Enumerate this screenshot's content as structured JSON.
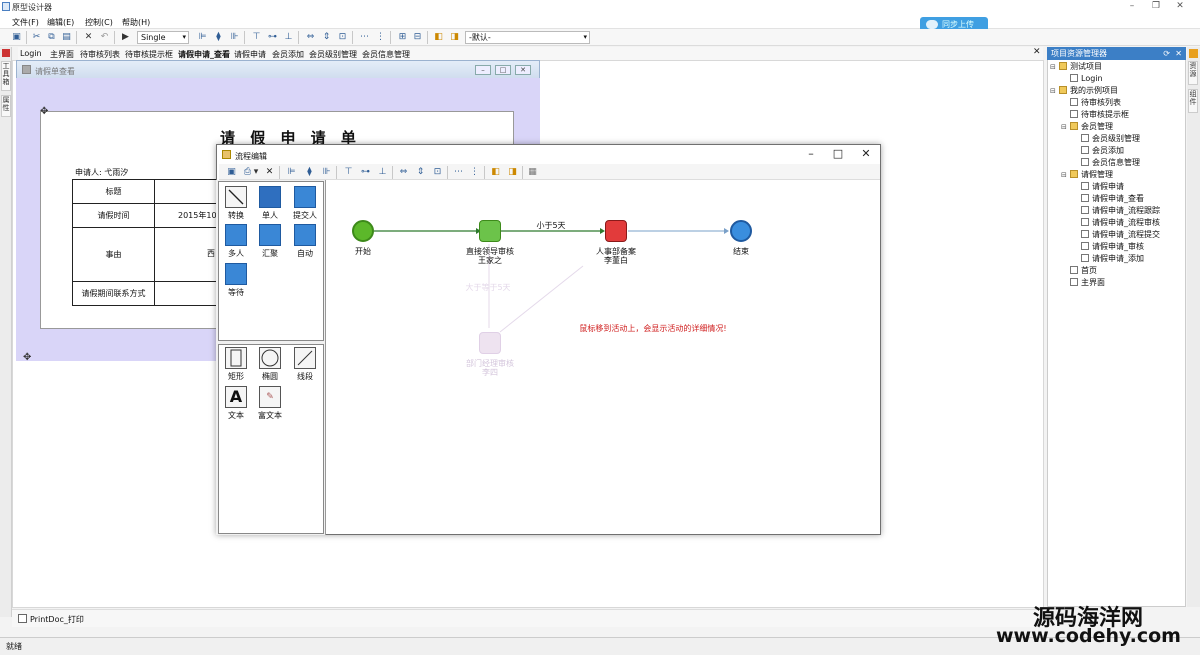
{
  "app": {
    "title": "原型设计器"
  },
  "menu": {
    "items": [
      "文件(F)",
      "编辑(E)",
      "控制(C)",
      "帮助(H)"
    ]
  },
  "toolbar": {
    "mode_select": "Single",
    "default_select": "-默认-"
  },
  "cloud_button": {
    "label": "同步上传"
  },
  "tabs": [
    "Login",
    "主界面",
    "待审核列表",
    "待审核提示框",
    "请假申请_查看",
    "请假申请",
    "会员添加",
    "会员级别管理",
    "会员信息管理"
  ],
  "left_strip": {
    "labels": [
      "工具箱",
      "属性"
    ]
  },
  "form_window": {
    "title": "请假单查看",
    "form_title": "请 假 申 请 单",
    "applicant": "申请人:  弋雨汐",
    "rows": [
      "标题",
      "请假时间",
      "事由",
      "请假期间联系方式"
    ],
    "date_value": "2015年10月",
    "reason_value": "西"
  },
  "flow_window": {
    "title": "流程编辑",
    "palette": [
      "转换",
      "单人",
      "提交人",
      "多人",
      "汇聚",
      "自动",
      "等待"
    ],
    "shapes": [
      "矩形",
      "椭圆",
      "线段",
      "文本",
      "富文本"
    ],
    "nodes": {
      "start": "开始",
      "direct": "直接领导审核",
      "direct_person": "王家之",
      "hr": "人事部备案",
      "hr_person": "李董白",
      "end": "结束",
      "dept": "部门经理审核",
      "dept_person": "李四"
    },
    "edge_label": "小于5天",
    "faded_edge_label": "大于等于5天",
    "hint": "鼠标移到活动上，会显示活动的详细情况!"
  },
  "project_panel": {
    "title": "项目资源管理器",
    "tree": [
      {
        "label": "测试项目",
        "level": 0
      },
      {
        "label": "Login",
        "level": 1
      },
      {
        "label": "我的示例项目",
        "level": 0
      },
      {
        "label": "待审核列表",
        "level": 1
      },
      {
        "label": "待审核提示框",
        "level": 1
      },
      {
        "label": "会员管理",
        "level": 1
      },
      {
        "label": "会员级别管理",
        "level": 2
      },
      {
        "label": "会员添加",
        "level": 2
      },
      {
        "label": "会员信息管理",
        "level": 2
      },
      {
        "label": "请假管理",
        "level": 1
      },
      {
        "label": "请假申请",
        "level": 2
      },
      {
        "label": "请假申请_查看",
        "level": 2
      },
      {
        "label": "请假申请_流程跟踪",
        "level": 2
      },
      {
        "label": "请假申请_流程审核",
        "level": 2
      },
      {
        "label": "请假申请_流程提交",
        "level": 2
      },
      {
        "label": "请假申请_审核",
        "level": 2
      },
      {
        "label": "请假申请_添加",
        "level": 2
      },
      {
        "label": "首页",
        "level": 1
      },
      {
        "label": "主界面",
        "level": 1
      }
    ]
  },
  "right_strip": {
    "labels": [
      "资源",
      "组件"
    ]
  },
  "bottom": {
    "print_doc": "PrintDoc_打印"
  },
  "status": {
    "text": "就绪"
  },
  "watermark": {
    "line1": "源码海洋网",
    "line2": "www.codehy.com"
  }
}
